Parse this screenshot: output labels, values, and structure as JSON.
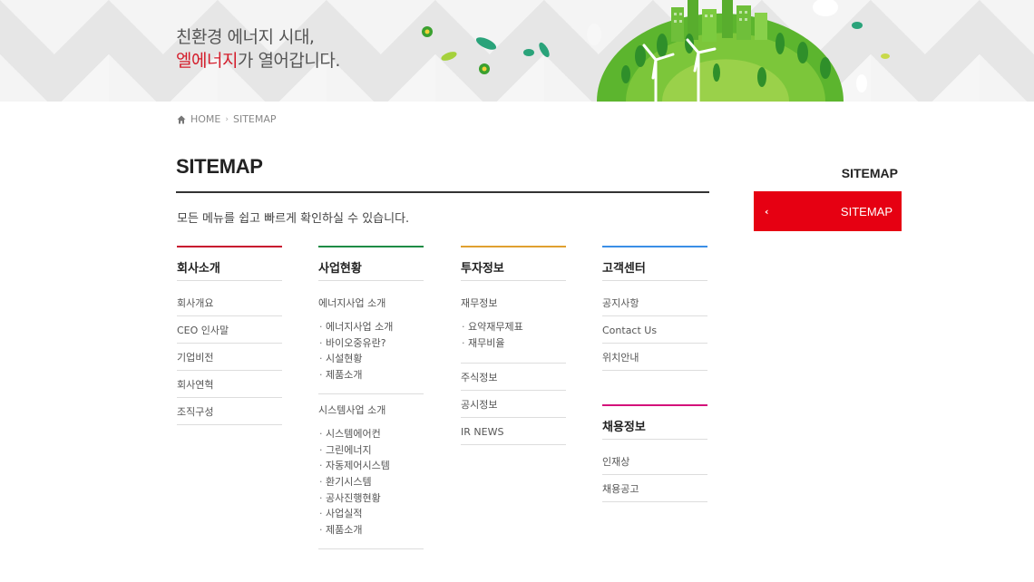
{
  "banner": {
    "slogan_line1": "친환경 에너지 시대,",
    "slogan_brand": "엘에너지",
    "slogan_line2_rest": "가 열어갑니다."
  },
  "breadcrumb": {
    "home": "HOME",
    "separator": "›",
    "current": "SITEMAP"
  },
  "page": {
    "title": "SITEMAP",
    "intro": "모든 메뉴를 쉽고 빠르게 확인하실 수 있습니다."
  },
  "columns": [
    {
      "title": "회사소개",
      "accent": "#c8102e",
      "items": [
        "회사개요",
        "CEO 인사말",
        "기업비전",
        "회사연혁",
        "조직구성"
      ]
    },
    {
      "title": "사업현황",
      "accent": "#1e8c45",
      "groups": [
        {
          "label": "에너지사업 소개",
          "subs": [
            "에너지사업 소개",
            "바이오중유란?",
            "시설현황",
            "제품소개"
          ]
        },
        {
          "label": "시스템사업 소개",
          "subs": [
            "시스템에어컨",
            "그린에너지",
            "자동제어시스템",
            "환기시스템",
            "공사진행현황",
            "사업실적",
            "제품소개"
          ]
        }
      ]
    },
    {
      "title": "투자정보",
      "accent": "#e0a030",
      "groups": [
        {
          "label": "재무정보",
          "subs": [
            "요약재무제표",
            "재무비율"
          ]
        }
      ],
      "items": [
        "주식정보",
        "공시정보",
        "IR NEWS"
      ]
    },
    {
      "title": "고객센터",
      "accent": "#3a8ee6",
      "items": [
        "공지사항",
        "Contact Us",
        "위치안내"
      ]
    },
    {
      "title": "채용정보",
      "accent": "#d4127a",
      "items": [
        "인재상",
        "채용공고"
      ]
    }
  ],
  "sidebar": {
    "title": "SITEMAP",
    "button_label": "SITEMAP",
    "button_icon": "chevron-left-icon",
    "button_color": "#e60012"
  }
}
